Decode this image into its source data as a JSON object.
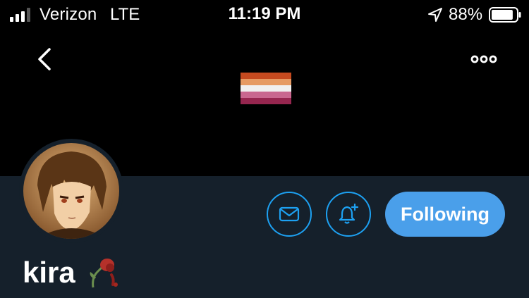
{
  "status_bar": {
    "carrier": "Verizon",
    "network": "LTE",
    "time": "11:19 PM",
    "battery_percent": "88%",
    "signal_bars_filled": 3,
    "battery_level": 0.88
  },
  "header": {
    "back_icon": "chevron-left-icon",
    "more_icon": "more-horizontal-icon",
    "banner_flag_colors": [
      "#c54a1f",
      "#e69a63",
      "#f0efef",
      "#c9678f",
      "#96264f"
    ]
  },
  "profile": {
    "display_name": "kira",
    "name_emoji_icon": "wilted-rose-icon",
    "following_label": "Following",
    "dm_icon": "envelope-icon",
    "notify_icon": "bell-plus-icon"
  },
  "colors": {
    "background": "#000000",
    "profile_background": "#15202b",
    "accent": "#1da1f2",
    "following_button": "#4a9fea"
  }
}
